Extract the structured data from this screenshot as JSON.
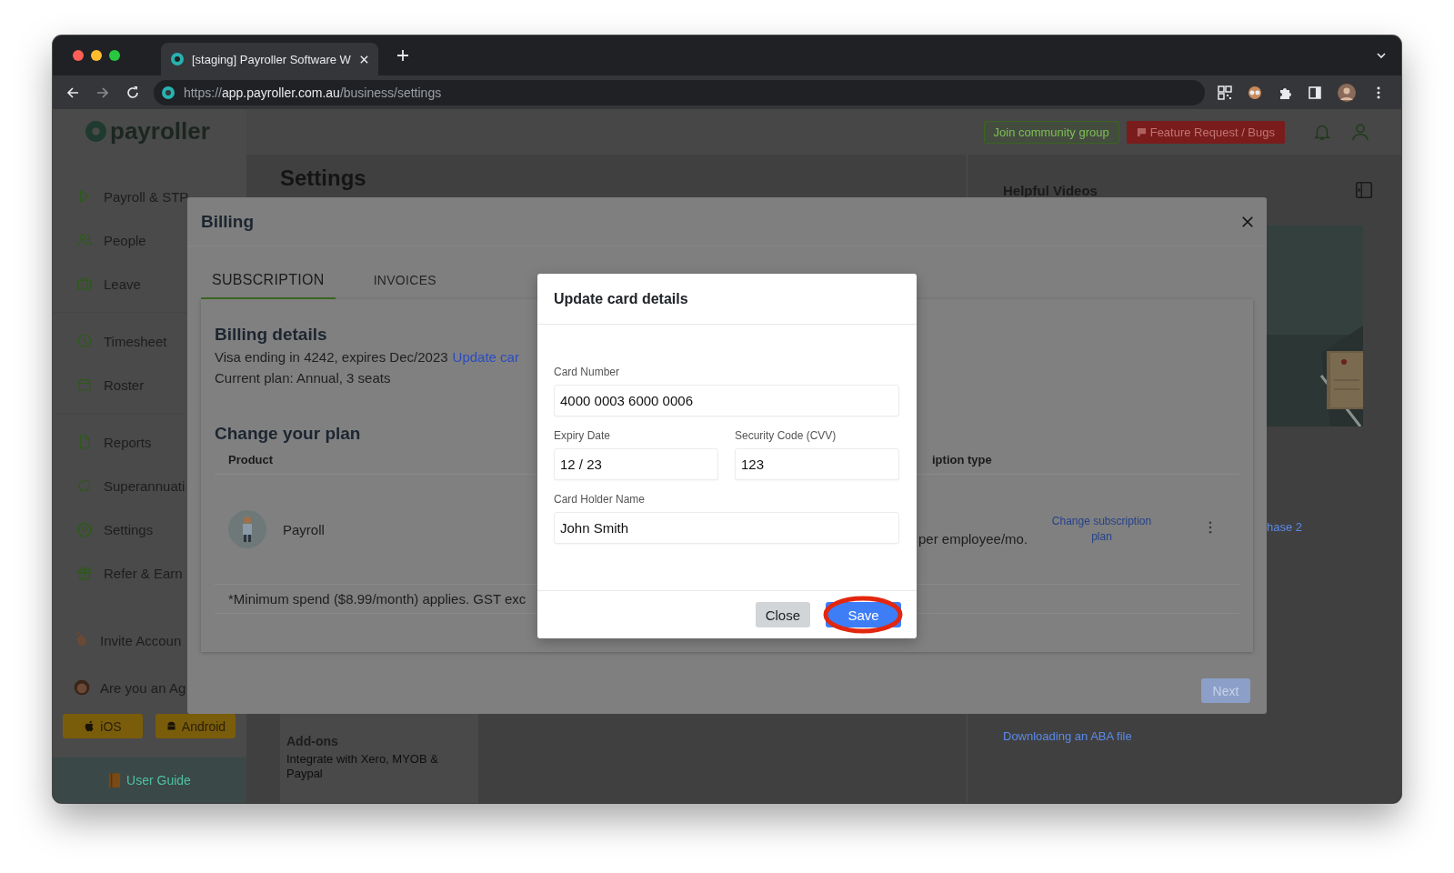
{
  "browser": {
    "tab_title": "[staging] Payroller Software W",
    "url": {
      "scheme": "https://",
      "host": "app.payroller.com.au",
      "path": "/business/settings"
    }
  },
  "app": {
    "logo": "payroller",
    "header_buttons": [
      {
        "label": "Join community group",
        "kind": "community"
      },
      {
        "label": "Feature Request / Bugs",
        "kind": "feature"
      }
    ]
  },
  "sidebar": {
    "groups": [
      [
        "Payroll & STP",
        "People",
        "Leave"
      ],
      [
        "Timesheet",
        "Roster"
      ],
      [
        "Reports",
        "Superannuati",
        "Settings",
        "Refer & Earn"
      ]
    ],
    "secondary": [
      "Invite Accoun",
      "Are you an Ag"
    ],
    "app_buttons": [
      "iOS",
      "Android"
    ],
    "footer_link": "User Guide"
  },
  "page": {
    "title": "Settings",
    "addon_card": {
      "title": "Add-ons",
      "text": "Integrate with Xero, MYOB & Paypal"
    }
  },
  "help_panel": {
    "title": "Helpful Videos",
    "partial_link": "hase 2",
    "bottom_link": "Downloading an ABA file"
  },
  "billing_modal": {
    "title": "Billing",
    "tabs": [
      {
        "label": "SUBSCRIPTION",
        "selected": true
      },
      {
        "label": "INVOICES",
        "selected": false
      }
    ],
    "details_title": "Billing details",
    "card_line": "Visa ending in 4242, expires Dec/2023",
    "update_link": "Update car",
    "plan_line": "Current plan: Annual, 3 seats",
    "plan_title": "Change your plan",
    "table": {
      "columns": [
        "Product",
        "iption type"
      ],
      "rows": [
        {
          "product": "Payroll",
          "price": "per employee/mo.",
          "action": "Change subscription plan"
        }
      ]
    },
    "footnote": "*Minimum spend ($8.99/month) applies. GST exc",
    "next_button": {
      "label": "Next",
      "disabled": true
    }
  },
  "card_modal": {
    "title": "Update card details",
    "rows": [
      [
        {
          "label": "Card Number",
          "value": "4000 0003 6000 0006"
        }
      ],
      [
        {
          "label": "Expiry Date",
          "value": "12 / 23"
        },
        {
          "label": "Security Code (CVV)",
          "value": "123"
        }
      ],
      [
        {
          "label": "Card Holder Name",
          "value": "John Smith"
        }
      ]
    ],
    "buttons": [
      {
        "label": "Close",
        "kind": "secondary",
        "highlighted": false
      },
      {
        "label": "Save",
        "kind": "primary",
        "highlighted": true
      }
    ]
  }
}
